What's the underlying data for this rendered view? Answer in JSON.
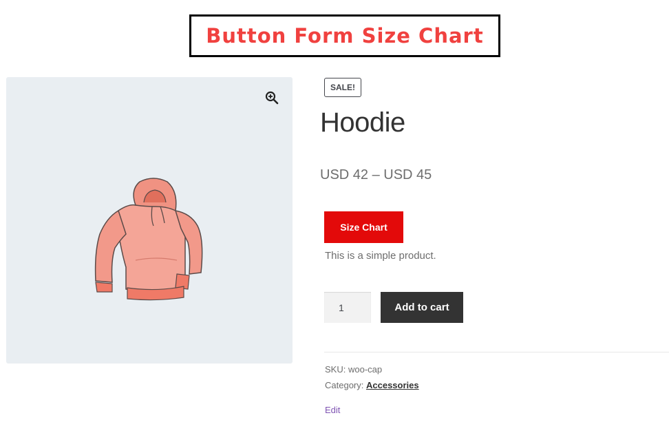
{
  "banner": {
    "title": "Button Form Size Chart"
  },
  "gallery": {
    "zoom_icon": "zoom-in-icon",
    "image": "hoodie-image"
  },
  "product": {
    "badge": "SALE!",
    "title": "Hoodie",
    "price": "USD 42 – USD 45",
    "size_chart_label": "Size Chart",
    "short_description": "This is a simple product.",
    "quantity": "1",
    "add_to_cart_label": "Add to cart"
  },
  "meta": {
    "sku_label": "SKU:",
    "sku_value": "woo-cap",
    "category_label": "Category:",
    "category_value": "Accessories",
    "edit_label": "Edit"
  },
  "colors": {
    "banner_text": "#f0413f",
    "size_chart_button": "#e30a0a",
    "add_to_cart_button": "#333333",
    "gallery_background": "#e9eef2",
    "edit_link": "#7f54b3"
  }
}
